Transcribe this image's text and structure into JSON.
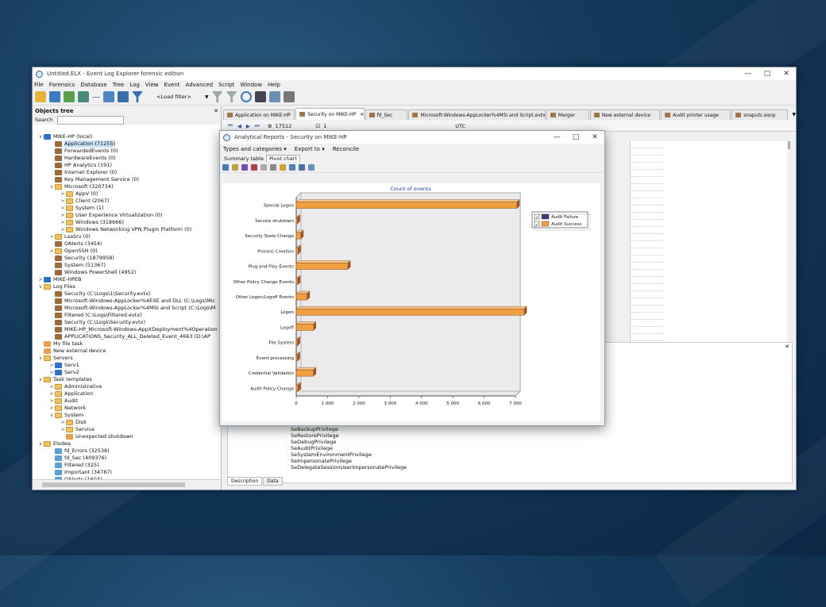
{
  "window": {
    "title": "Untitled.ELX - Event Log Explorer forensic edition"
  },
  "menu": [
    "File",
    "Forensics",
    "Database",
    "Tree",
    "Log",
    "View",
    "Event",
    "Advanced",
    "Script",
    "Window",
    "Help"
  ],
  "toolbar": {
    "load_filter": "<Load filter>"
  },
  "objects_tree": {
    "title": "Objects tree",
    "search_label": "Search",
    "nodes": [
      {
        "label": "MIKE-HP (local)",
        "level": 0,
        "icon": "pc",
        "toggle": "v"
      },
      {
        "label": "Application (71255)",
        "level": 1,
        "icon": "log",
        "selected": true
      },
      {
        "label": "ForwardedEvents (0)",
        "level": 1,
        "icon": "log"
      },
      {
        "label": "HardwareEvents (0)",
        "level": 1,
        "icon": "log"
      },
      {
        "label": "HP Analytics (191)",
        "level": 1,
        "icon": "log"
      },
      {
        "label": "Internet Explorer (0)",
        "level": 1,
        "icon": "log"
      },
      {
        "label": "Key Management Service (0)",
        "level": 1,
        "icon": "log"
      },
      {
        "label": "Microsoft (320734)",
        "level": 1,
        "icon": "folder",
        "toggle": "v"
      },
      {
        "label": "AppV (0)",
        "level": 2,
        "icon": "folder",
        "toggle": ">"
      },
      {
        "label": "Client (2067)",
        "level": 2,
        "icon": "folder",
        "toggle": ">"
      },
      {
        "label": "System (1)",
        "level": 2,
        "icon": "folder",
        "toggle": ">"
      },
      {
        "label": "User Experience Virtualization (0)",
        "level": 2,
        "icon": "folder",
        "toggle": ">"
      },
      {
        "label": "Windows (318666)",
        "level": 2,
        "icon": "folder",
        "toggle": ">"
      },
      {
        "label": "Windows Networking VPN Plugin Platform (0)",
        "level": 2,
        "icon": "folder",
        "toggle": ">"
      },
      {
        "label": "LsaSrv (0)",
        "level": 1,
        "icon": "folder",
        "toggle": ">"
      },
      {
        "label": "OAlerts (3454)",
        "level": 1,
        "icon": "log"
      },
      {
        "label": "OpenSSH (0)",
        "level": 1,
        "icon": "folder",
        "toggle": ">"
      },
      {
        "label": "Security (1879958)",
        "level": 1,
        "icon": "log"
      },
      {
        "label": "System (51367)",
        "level": 1,
        "icon": "log"
      },
      {
        "label": "Windows PowerShell (4952)",
        "level": 1,
        "icon": "log"
      },
      {
        "label": "MIKE-HPEB",
        "level": 0,
        "icon": "pc",
        "toggle": ">"
      },
      {
        "label": "Log Files",
        "level": 0,
        "icon": "folder",
        "toggle": "v"
      },
      {
        "label": "Security (C:\\Logs\\1\\Security.evtx)",
        "level": 1,
        "icon": "log"
      },
      {
        "label": "Microsoft-Windows-AppLocker%4EXE and DLL (C:\\Logs\\Mic",
        "level": 1,
        "icon": "log"
      },
      {
        "label": "Microsoft-Windows-AppLocker%4MSI and Script (C:\\Logs\\M",
        "level": 1,
        "icon": "log"
      },
      {
        "label": "Filtered (C:\\Logs\\Filtered.evtx)",
        "level": 1,
        "icon": "log"
      },
      {
        "label": "Security (C:\\Logs\\Security.evtx)",
        "level": 1,
        "icon": "log"
      },
      {
        "label": "MIKE-HP_Microsoft-Windows-AppXDeployment%4Operation",
        "level": 1,
        "icon": "log"
      },
      {
        "label": "APPLICATIONS_Security_ALL_Deleted_Event_4663 (D:\\AP",
        "level": 1,
        "icon": "log"
      },
      {
        "label": "My file task",
        "level": 0,
        "icon": "task"
      },
      {
        "label": "New external device",
        "level": 0,
        "icon": "task"
      },
      {
        "label": "Servers",
        "level": 0,
        "icon": "folder",
        "toggle": "v"
      },
      {
        "label": "Serv1",
        "level": 1,
        "icon": "pc",
        "toggle": ">"
      },
      {
        "label": "Serv2",
        "level": 1,
        "icon": "pc",
        "toggle": ">"
      },
      {
        "label": "Task templates",
        "level": 0,
        "icon": "folder",
        "toggle": "v"
      },
      {
        "label": "Administrative",
        "level": 1,
        "icon": "folder",
        "toggle": ">"
      },
      {
        "label": "Application",
        "level": 1,
        "icon": "folder",
        "toggle": ">"
      },
      {
        "label": "Audit",
        "level": 1,
        "icon": "folder",
        "toggle": ">"
      },
      {
        "label": "Network",
        "level": 1,
        "icon": "folder",
        "toggle": ">"
      },
      {
        "label": "System",
        "level": 1,
        "icon": "folder",
        "toggle": "v"
      },
      {
        "label": "Disk",
        "level": 2,
        "icon": "folder",
        "toggle": ">"
      },
      {
        "label": "Service",
        "level": 2,
        "icon": "folder",
        "toggle": ">"
      },
      {
        "label": "Unexpected shutdown",
        "level": 2,
        "icon": "task"
      },
      {
        "label": "Elodea",
        "level": 0,
        "icon": "folder",
        "toggle": "v"
      },
      {
        "label": "fd_Errors (32538)",
        "level": 1,
        "icon": "file"
      },
      {
        "label": "fd_Sec (409376)",
        "level": 1,
        "icon": "file"
      },
      {
        "label": "Filtered (325)",
        "level": 1,
        "icon": "file"
      },
      {
        "label": "Important (34787)",
        "level": 1,
        "icon": "file"
      },
      {
        "label": "OAlerts (1604)",
        "level": 1,
        "icon": "file"
      }
    ]
  },
  "tabs": [
    {
      "label": "Application on MIKE-HP",
      "width": 84
    },
    {
      "label": "Security on MIKE-HP",
      "width": 80,
      "active": true
    },
    {
      "label": "fd_Sec",
      "width": 46
    },
    {
      "label": "Microsoft-Windows-AppLocker%4MSI and Script.evtx",
      "width": 170
    },
    {
      "label": "Merger",
      "width": 46
    },
    {
      "label": "New external device",
      "width": 82
    },
    {
      "label": "Audit printer usage",
      "width": 82
    },
    {
      "label": "snaputc.esnp",
      "width": 64
    }
  ],
  "navbar": {
    "count": "17512",
    "checked": "1",
    "tz": "UTC"
  },
  "privileges": [
    "SeBackupPrivilege",
    "SeRestorePrivilege",
    "SeDebugPrivilege",
    "SeAuditPrivilege",
    "SeSystemEnvironmentPrivilege",
    "SeImpersonatePrivilege",
    "SeDelegateSessionUserImpersonatePrivilege"
  ],
  "bottom_tabs": [
    "Description",
    "Data"
  ],
  "dialog": {
    "title": "Analytical Reports - Security on MIKE-HP",
    "menu": [
      "Types and categories",
      "Export to",
      "Reconcile"
    ],
    "tabs": [
      "Summary table",
      "Pivot chart"
    ]
  },
  "colors": {
    "failure": "#3c3c78",
    "success": "#f0a040",
    "success_dark": "#a0522d"
  },
  "chart_data": {
    "type": "bar",
    "orientation": "horizontal",
    "title": "Count of events",
    "categories": [
      "Special Logon",
      "Service shutdown",
      "Security State Change",
      "Process Creation",
      "Plug and Play Events",
      "Other Policy Change Events",
      "Other Logon/Logoff Events",
      "Logon",
      "Logoff",
      "File System",
      "Event processing",
      "Credential Validation",
      "Audit Policy Change"
    ],
    "series": [
      {
        "name": "Audit Failure",
        "values": [
          0,
          0,
          0,
          0,
          0,
          0,
          0,
          0,
          0,
          0,
          0,
          0,
          0
        ]
      },
      {
        "name": "Audit Success",
        "values": [
          7050,
          40,
          150,
          60,
          1650,
          50,
          350,
          7300,
          550,
          40,
          20,
          550,
          60
        ]
      }
    ],
    "xlim": [
      0,
      7000
    ],
    "xticks": [
      "0",
      "1 000",
      "2 000",
      "3 000",
      "4 000",
      "5 000",
      "6 000",
      "7 000"
    ],
    "legend": "top-right",
    "grid": false
  }
}
